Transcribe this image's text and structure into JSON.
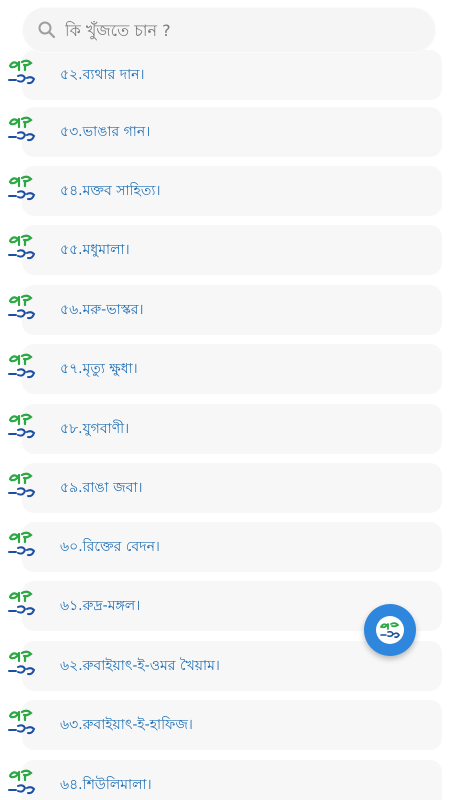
{
  "search": {
    "placeholder": "কি খুঁজতে চান ?"
  },
  "colors": {
    "title_text": "#1f6fb5",
    "card_background": "#f7f7f7",
    "fab_background": "#2f86dd",
    "logo_green": "#2aa843",
    "logo_blue": "#1d4fa3"
  },
  "icons": {
    "search": "search-icon",
    "item_logo": "boi-tong-logo-icon",
    "fab": "boi-tong-logo-icon"
  },
  "items": [
    {
      "label": "৫২.ব্যথার দান।"
    },
    {
      "label": "৫৩.ভাঙার গান।"
    },
    {
      "label": "৫৪.মক্তব সাহিত্য।"
    },
    {
      "label": "৫৫.মধুমালা।"
    },
    {
      "label": "৫৬.মরু-ভাস্কর।"
    },
    {
      "label": "৫৭.মৃত্যু ক্ষুধা।"
    },
    {
      "label": "৫৮.যুগবাণী।"
    },
    {
      "label": "৫৯.রাঙা জবা।"
    },
    {
      "label": "৬০.রিক্তের বেদন।"
    },
    {
      "label": "৬১.রুদ্র-মঙ্গল।"
    },
    {
      "label": "৬২.রুবাইয়াৎ-ই-ওমর খৈয়াম।"
    },
    {
      "label": "৬৩.রুবাইয়াৎ-ই-হাফিজ।"
    },
    {
      "label": "৬৪.শিউলিমালা।"
    }
  ]
}
